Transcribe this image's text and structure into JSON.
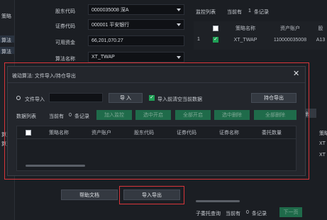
{
  "left_nav": {
    "items": [
      "策略",
      "算法",
      "算法",
      "",
      "",
      "",
      "",
      "",
      "算法",
      "算法"
    ]
  },
  "form": {
    "account_label": "股东代码",
    "account_value": "0000035008 深A",
    "code_label": "证券代码",
    "code_value": "000001 平安银行",
    "funds_label": "可用资金",
    "funds_value": "66,201,070.27",
    "algo_label": "算法名称",
    "algo_value": "XT_TWAP"
  },
  "monitor": {
    "title": "监控列表",
    "count_text": "当前有",
    "count": "1",
    "count_unit": "条记录",
    "headers": [
      "策略名称",
      "资产账户",
      "股"
    ],
    "row": {
      "index": "1",
      "strategy": "XT_TWAP",
      "account": "110000035008",
      "extra": "A13"
    }
  },
  "dialog": {
    "title": "被动算法: 文件导入/持仓导出",
    "file_import_label": "文件导入",
    "file_path": "",
    "import_button": "导 入",
    "clear_label": "导入前清空当前数据",
    "export_button": "持仓导出",
    "data_list_label": "数据列表",
    "count_text": "当前有",
    "count": "0",
    "count_unit": "条记录",
    "actions": [
      "加入监控",
      "选中开启",
      "全部开启",
      "选中删除",
      "全部删除"
    ],
    "headers": [
      "策略名称",
      "资产账户",
      "股东代码",
      "证券代码",
      "证券名称",
      "委托数量"
    ]
  },
  "right_fragments": [
    "除",
    "策略",
    "XT",
    "XT"
  ],
  "bottom": {
    "help_button": "帮助文档",
    "import_export_button": "导入导出",
    "sub_query_label": "子委托查询",
    "count_text": "当前有",
    "count": "0",
    "count_unit": "条记录",
    "next_page_button": "下一页"
  },
  "colors": {
    "accent_green": "#1fa055",
    "highlight_red": "#d8353a",
    "dialog_bg": "#23262c"
  }
}
